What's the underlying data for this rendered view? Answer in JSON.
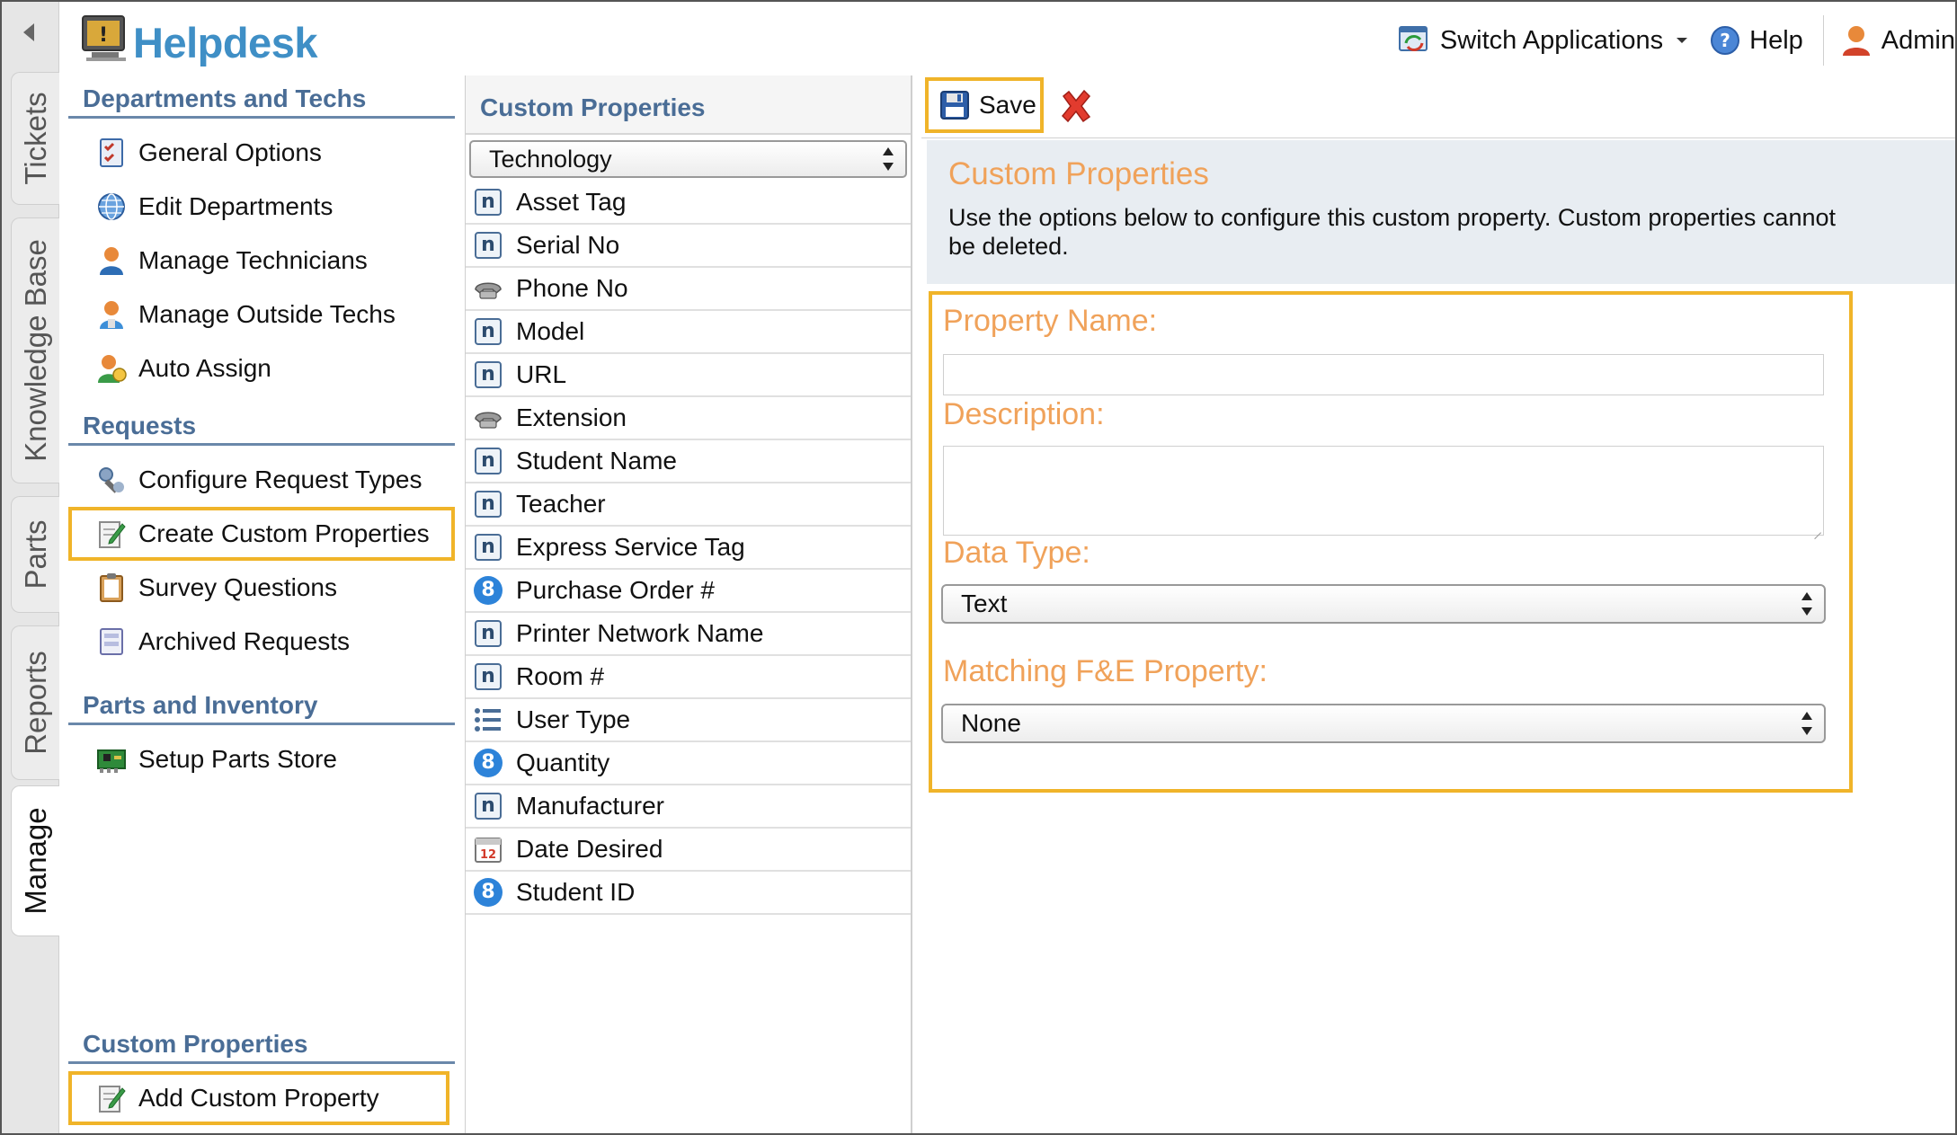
{
  "app": {
    "title": "Helpdesk"
  },
  "header": {
    "switch_apps": "Switch Applications",
    "help": "Help",
    "user": "Admin"
  },
  "vertical_tabs": [
    {
      "label": "Tickets",
      "active": false
    },
    {
      "label": "Knowledge Base",
      "active": false
    },
    {
      "label": "Parts",
      "active": false
    },
    {
      "label": "Reports",
      "active": false
    },
    {
      "label": "Manage",
      "active": true
    }
  ],
  "nav": {
    "departments": {
      "heading": "Departments and Techs",
      "items": [
        "General Options",
        "Edit Departments",
        "Manage Technicians",
        "Manage Outside Techs",
        "Auto Assign"
      ]
    },
    "requests": {
      "heading": "Requests",
      "items": [
        "Configure Request Types",
        "Create Custom Properties",
        "Survey Questions",
        "Archived Requests"
      ]
    },
    "parts": {
      "heading": "Parts and Inventory",
      "items": [
        "Setup Parts Store"
      ]
    },
    "custom": {
      "heading": "Custom Properties",
      "items": [
        "Add Custom Property"
      ]
    }
  },
  "middle": {
    "title": "Custom Properties",
    "category_selected": "Technology",
    "properties": [
      {
        "name": "Asset Tag",
        "icon": "text-n-icon"
      },
      {
        "name": "Serial No",
        "icon": "text-n-icon"
      },
      {
        "name": "Phone No",
        "icon": "phone-icon"
      },
      {
        "name": "Model",
        "icon": "text-n-icon"
      },
      {
        "name": "URL",
        "icon": "text-n-icon"
      },
      {
        "name": "Extension",
        "icon": "phone-icon"
      },
      {
        "name": "Student Name",
        "icon": "text-n-icon"
      },
      {
        "name": "Teacher",
        "icon": "text-n-icon"
      },
      {
        "name": "Express Service Tag",
        "icon": "text-n-icon"
      },
      {
        "name": "Purchase Order #",
        "icon": "number-8-icon"
      },
      {
        "name": "Printer Network Name",
        "icon": "text-n-icon"
      },
      {
        "name": "Room #",
        "icon": "text-n-icon"
      },
      {
        "name": "User Type",
        "icon": "list-icon"
      },
      {
        "name": "Quantity",
        "icon": "number-8-icon"
      },
      {
        "name": "Manufacturer",
        "icon": "text-n-icon"
      },
      {
        "name": "Date Desired",
        "icon": "calendar-icon"
      },
      {
        "name": "Student ID",
        "icon": "number-8-icon"
      }
    ]
  },
  "toolbar": {
    "save_label": "Save"
  },
  "info": {
    "title": "Custom Properties",
    "text": "Use the options below to configure this custom property. Custom properties cannot be deleted."
  },
  "form": {
    "property_name_label": "Property Name:",
    "property_name_value": "",
    "description_label": "Description:",
    "description_value": "",
    "data_type_label": "Data Type:",
    "data_type_value": "Text",
    "matching_label": "Matching F&E Property:",
    "matching_value": "None"
  },
  "colors": {
    "brand_blue": "#3f8fc6",
    "heading_blue": "#4a6d96",
    "highlight": "#f0b429",
    "form_label_orange": "#f0a25a"
  }
}
